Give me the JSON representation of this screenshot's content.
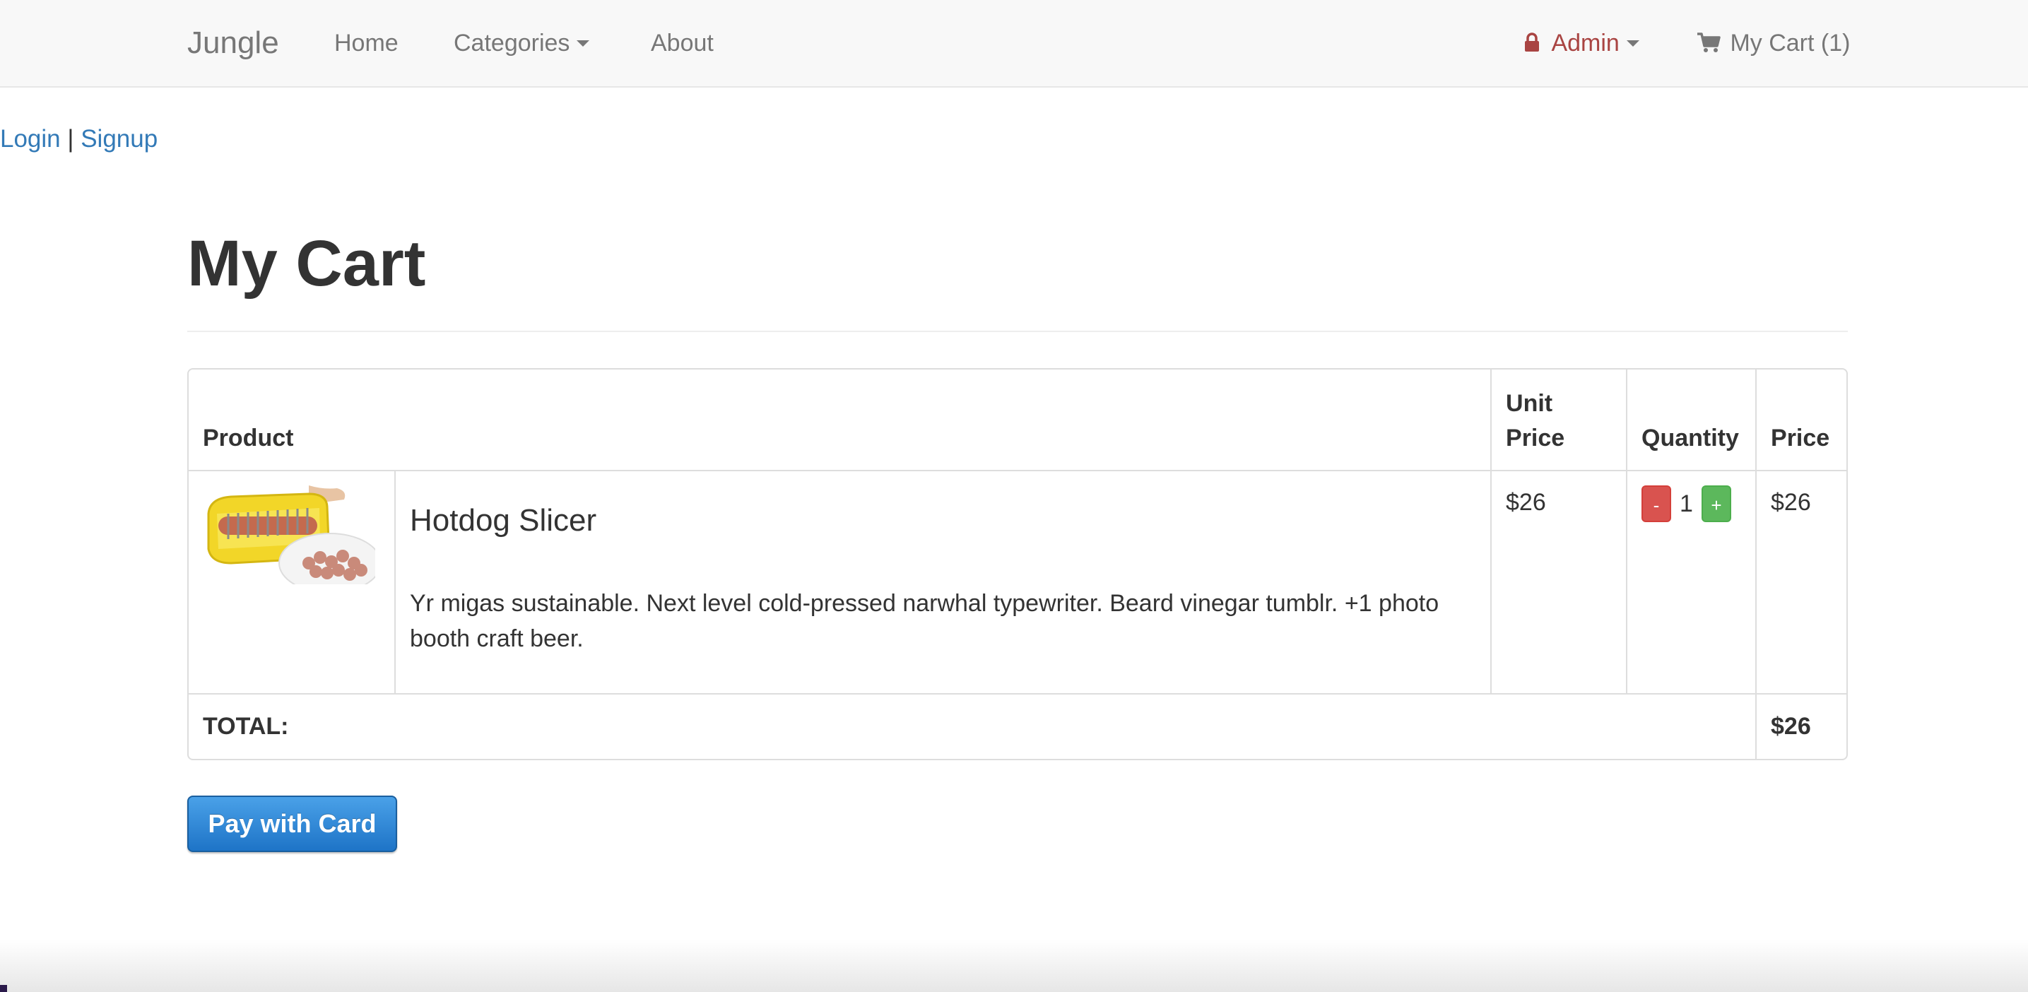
{
  "navbar": {
    "brand": "Jungle",
    "home": "Home",
    "categories": "Categories",
    "about": "About",
    "admin": "Admin",
    "cart": "My Cart (1)",
    "admin_color": "#a94442"
  },
  "auth": {
    "login": "Login",
    "separator": "|",
    "signup": "Signup"
  },
  "page": {
    "title": "My Cart"
  },
  "table": {
    "headers": {
      "product": "Product",
      "unit_price": "Unit Price",
      "quantity": "Quantity",
      "price": "Price"
    },
    "items": [
      {
        "image": "hotdog slicer product photo",
        "name": "Hotdog Slicer",
        "description": "Yr migas sustainable. Next level cold-pressed narwhal typewriter. Beard vinegar tumblr. +1 photo booth craft beer.",
        "unit_price": "$26",
        "quantity": "1",
        "minus_label": "-",
        "plus_label": "+",
        "price": "$26"
      }
    ],
    "total_label": "TOTAL:",
    "total_value": "$26"
  },
  "pay_button": "Pay with Card",
  "colors": {
    "link": "#337ab7",
    "minus": "#d9534f",
    "plus": "#5cb85c",
    "pay": "#2d8ad9"
  }
}
